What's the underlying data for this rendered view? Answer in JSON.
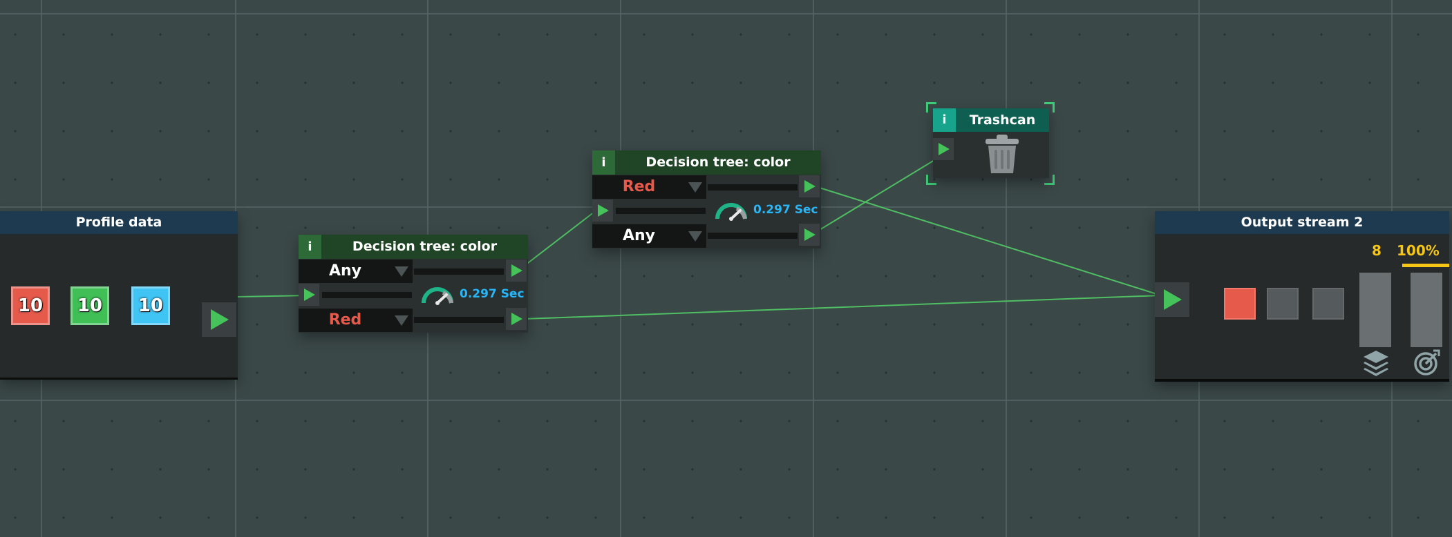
{
  "nodes": {
    "profile": {
      "title": "Profile data",
      "chips": [
        {
          "value": "10",
          "color": "#e55a4b"
        },
        {
          "value": "10",
          "color": "#3fbf56"
        },
        {
          "value": "10",
          "color": "#40c4f4"
        }
      ]
    },
    "decision1": {
      "info": "i",
      "title": "Decision tree: color",
      "select_top": "Any",
      "select_bottom": "Red",
      "speed": "0.297 Sec"
    },
    "decision2": {
      "info": "i",
      "title": "Decision tree: color",
      "select_top": "Red",
      "select_bottom": "Any",
      "speed": "0.297 Sec"
    },
    "trashcan": {
      "info": "i",
      "title": "Trashcan"
    },
    "output": {
      "title": "Output stream 2",
      "count": "8",
      "percent": "100%",
      "slots": [
        "#e55a4b",
        "#555a5c",
        "#555a5c"
      ],
      "icons": [
        "layers-icon",
        "target-icon"
      ]
    }
  },
  "colors": {
    "background": "#3b4848",
    "wire": "#4fbf63",
    "any_text": "#ffffff",
    "red_text": "#e55a4b",
    "speed_text": "#29b6f6",
    "stat_text": "#f5c518"
  }
}
